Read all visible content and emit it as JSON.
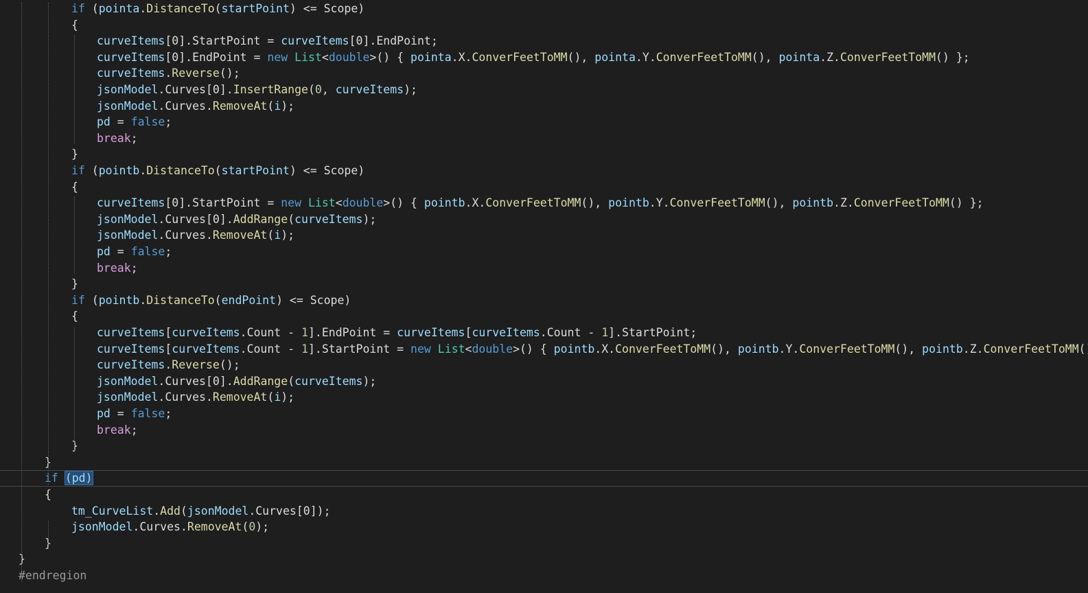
{
  "editor": {
    "colors": {
      "background": "#1e1e1e",
      "keyword": "#569cd6",
      "control": "#d8a0df",
      "type": "#4ec9b0",
      "identifier": "#9cdcfe",
      "method": "#dcdcaa",
      "number": "#b5cea8",
      "punctuation": "#dcdcdc",
      "preprocessor": "#9b9b9b",
      "selection": "#264f78"
    },
    "lines": [
      {
        "indent": 3,
        "tokens": [
          [
            "kw",
            "if"
          ],
          [
            "p",
            " ("
          ],
          [
            "id",
            "pointa"
          ],
          [
            "p",
            "."
          ],
          [
            "m",
            "DistanceTo"
          ],
          [
            "p",
            "("
          ],
          [
            "id",
            "startPoint"
          ],
          [
            "p",
            ") <= "
          ],
          [
            "pr",
            "Scope"
          ],
          [
            "p",
            ")"
          ]
        ]
      },
      {
        "indent": 3,
        "tokens": [
          [
            "p",
            "{"
          ]
        ]
      },
      {
        "indent": 4,
        "tokens": [
          [
            "id",
            "curveItems"
          ],
          [
            "p",
            "[0]."
          ],
          [
            "pr",
            "StartPoint"
          ],
          [
            "p",
            " = "
          ],
          [
            "id",
            "curveItems"
          ],
          [
            "p",
            "[0]."
          ],
          [
            "pr",
            "EndPoint"
          ],
          [
            "p",
            ";"
          ]
        ]
      },
      {
        "indent": 4,
        "tokens": [
          [
            "id",
            "curveItems"
          ],
          [
            "p",
            "[0]."
          ],
          [
            "pr",
            "EndPoint"
          ],
          [
            "p",
            " = "
          ],
          [
            "kw",
            "new"
          ],
          [
            "p",
            " "
          ],
          [
            "t",
            "List"
          ],
          [
            "p",
            "<"
          ],
          [
            "kw",
            "double"
          ],
          [
            "p",
            ">() { "
          ],
          [
            "id",
            "pointa"
          ],
          [
            "p",
            "."
          ],
          [
            "pr",
            "X"
          ],
          [
            "p",
            "."
          ],
          [
            "m",
            "ConverFeetToMM"
          ],
          [
            "p",
            "(), "
          ],
          [
            "id",
            "pointa"
          ],
          [
            "p",
            "."
          ],
          [
            "pr",
            "Y"
          ],
          [
            "p",
            "."
          ],
          [
            "m",
            "ConverFeetToMM"
          ],
          [
            "p",
            "(), "
          ],
          [
            "id",
            "pointa"
          ],
          [
            "p",
            "."
          ],
          [
            "pr",
            "Z"
          ],
          [
            "p",
            "."
          ],
          [
            "m",
            "ConverFeetToMM"
          ],
          [
            "p",
            "() };"
          ]
        ]
      },
      {
        "indent": 4,
        "tokens": [
          [
            "id",
            "curveItems"
          ],
          [
            "p",
            "."
          ],
          [
            "m",
            "Reverse"
          ],
          [
            "p",
            "();"
          ]
        ]
      },
      {
        "indent": 4,
        "tokens": [
          [
            "id",
            "jsonModel"
          ],
          [
            "p",
            "."
          ],
          [
            "pr",
            "Curves"
          ],
          [
            "p",
            "[0]."
          ],
          [
            "m",
            "InsertRange"
          ],
          [
            "p",
            "("
          ],
          [
            "n",
            "0"
          ],
          [
            "p",
            ", "
          ],
          [
            "id",
            "curveItems"
          ],
          [
            "p",
            ");"
          ]
        ]
      },
      {
        "indent": 4,
        "tokens": [
          [
            "id",
            "jsonModel"
          ],
          [
            "p",
            "."
          ],
          [
            "pr",
            "Curves"
          ],
          [
            "p",
            "."
          ],
          [
            "m",
            "RemoveAt"
          ],
          [
            "p",
            "("
          ],
          [
            "id",
            "i"
          ],
          [
            "p",
            ");"
          ]
        ]
      },
      {
        "indent": 4,
        "tokens": [
          [
            "id",
            "pd"
          ],
          [
            "p",
            " = "
          ],
          [
            "kw",
            "false"
          ],
          [
            "p",
            ";"
          ]
        ]
      },
      {
        "indent": 4,
        "tokens": [
          [
            "c",
            "break"
          ],
          [
            "p",
            ";"
          ]
        ]
      },
      {
        "indent": 3,
        "tokens": [
          [
            "p",
            "}"
          ]
        ]
      },
      {
        "indent": 3,
        "tokens": [
          [
            "kw",
            "if"
          ],
          [
            "p",
            " ("
          ],
          [
            "id",
            "pointb"
          ],
          [
            "p",
            "."
          ],
          [
            "m",
            "DistanceTo"
          ],
          [
            "p",
            "("
          ],
          [
            "id",
            "startPoint"
          ],
          [
            "p",
            ") <= "
          ],
          [
            "pr",
            "Scope"
          ],
          [
            "p",
            ")"
          ]
        ]
      },
      {
        "indent": 3,
        "tokens": [
          [
            "p",
            "{"
          ]
        ]
      },
      {
        "indent": 4,
        "tokens": [
          [
            "id",
            "curveItems"
          ],
          [
            "p",
            "[0]."
          ],
          [
            "pr",
            "StartPoint"
          ],
          [
            "p",
            " = "
          ],
          [
            "kw",
            "new"
          ],
          [
            "p",
            " "
          ],
          [
            "t",
            "List"
          ],
          [
            "p",
            "<"
          ],
          [
            "kw",
            "double"
          ],
          [
            "p",
            ">() { "
          ],
          [
            "id",
            "pointb"
          ],
          [
            "p",
            "."
          ],
          [
            "pr",
            "X"
          ],
          [
            "p",
            "."
          ],
          [
            "m",
            "ConverFeetToMM"
          ],
          [
            "p",
            "(), "
          ],
          [
            "id",
            "pointb"
          ],
          [
            "p",
            "."
          ],
          [
            "pr",
            "Y"
          ],
          [
            "p",
            "."
          ],
          [
            "m",
            "ConverFeetToMM"
          ],
          [
            "p",
            "(), "
          ],
          [
            "id",
            "pointb"
          ],
          [
            "p",
            "."
          ],
          [
            "pr",
            "Z"
          ],
          [
            "p",
            "."
          ],
          [
            "m",
            "ConverFeetToMM"
          ],
          [
            "p",
            "() };"
          ]
        ]
      },
      {
        "indent": 4,
        "tokens": [
          [
            "id",
            "jsonModel"
          ],
          [
            "p",
            "."
          ],
          [
            "pr",
            "Curves"
          ],
          [
            "p",
            "[0]."
          ],
          [
            "m",
            "AddRange"
          ],
          [
            "p",
            "("
          ],
          [
            "id",
            "curveItems"
          ],
          [
            "p",
            ");"
          ]
        ]
      },
      {
        "indent": 4,
        "tokens": [
          [
            "id",
            "jsonModel"
          ],
          [
            "p",
            "."
          ],
          [
            "pr",
            "Curves"
          ],
          [
            "p",
            "."
          ],
          [
            "m",
            "RemoveAt"
          ],
          [
            "p",
            "("
          ],
          [
            "id",
            "i"
          ],
          [
            "p",
            ");"
          ]
        ]
      },
      {
        "indent": 4,
        "tokens": [
          [
            "id",
            "pd"
          ],
          [
            "p",
            " = "
          ],
          [
            "kw",
            "false"
          ],
          [
            "p",
            ";"
          ]
        ]
      },
      {
        "indent": 4,
        "tokens": [
          [
            "c",
            "break"
          ],
          [
            "p",
            ";"
          ]
        ]
      },
      {
        "indent": 3,
        "tokens": [
          [
            "p",
            "}"
          ]
        ]
      },
      {
        "indent": 3,
        "tokens": [
          [
            "kw",
            "if"
          ],
          [
            "p",
            " ("
          ],
          [
            "id",
            "pointb"
          ],
          [
            "p",
            "."
          ],
          [
            "m",
            "DistanceTo"
          ],
          [
            "p",
            "("
          ],
          [
            "id",
            "endPoint"
          ],
          [
            "p",
            ") <= "
          ],
          [
            "pr",
            "Scope"
          ],
          [
            "p",
            ")"
          ]
        ]
      },
      {
        "indent": 3,
        "tokens": [
          [
            "p",
            "{"
          ]
        ]
      },
      {
        "indent": 4,
        "tokens": [
          [
            "id",
            "curveItems"
          ],
          [
            "p",
            "["
          ],
          [
            "id",
            "curveItems"
          ],
          [
            "p",
            "."
          ],
          [
            "pr",
            "Count"
          ],
          [
            "p",
            " - "
          ],
          [
            "n",
            "1"
          ],
          [
            "p",
            "]."
          ],
          [
            "pr",
            "EndPoint"
          ],
          [
            "p",
            " = "
          ],
          [
            "id",
            "curveItems"
          ],
          [
            "p",
            "["
          ],
          [
            "id",
            "curveItems"
          ],
          [
            "p",
            "."
          ],
          [
            "pr",
            "Count"
          ],
          [
            "p",
            " - "
          ],
          [
            "n",
            "1"
          ],
          [
            "p",
            "]."
          ],
          [
            "pr",
            "StartPoint"
          ],
          [
            "p",
            ";"
          ]
        ]
      },
      {
        "indent": 4,
        "tokens": [
          [
            "id",
            "curveItems"
          ],
          [
            "p",
            "["
          ],
          [
            "id",
            "curveItems"
          ],
          [
            "p",
            "."
          ],
          [
            "pr",
            "Count"
          ],
          [
            "p",
            " - "
          ],
          [
            "n",
            "1"
          ],
          [
            "p",
            "]."
          ],
          [
            "pr",
            "StartPoint"
          ],
          [
            "p",
            " = "
          ],
          [
            "kw",
            "new"
          ],
          [
            "p",
            " "
          ],
          [
            "t",
            "List"
          ],
          [
            "p",
            "<"
          ],
          [
            "kw",
            "double"
          ],
          [
            "p",
            ">() { "
          ],
          [
            "id",
            "pointb"
          ],
          [
            "p",
            "."
          ],
          [
            "pr",
            "X"
          ],
          [
            "p",
            "."
          ],
          [
            "m",
            "ConverFeetToMM"
          ],
          [
            "p",
            "(), "
          ],
          [
            "id",
            "pointb"
          ],
          [
            "p",
            "."
          ],
          [
            "pr",
            "Y"
          ],
          [
            "p",
            "."
          ],
          [
            "m",
            "ConverFeetToMM"
          ],
          [
            "p",
            "(), "
          ],
          [
            "id",
            "pointb"
          ],
          [
            "p",
            "."
          ],
          [
            "pr",
            "Z"
          ],
          [
            "p",
            "."
          ],
          [
            "m",
            "ConverFeetToMM"
          ],
          [
            "p",
            "() };"
          ]
        ]
      },
      {
        "indent": 4,
        "tokens": [
          [
            "id",
            "curveItems"
          ],
          [
            "p",
            "."
          ],
          [
            "m",
            "Reverse"
          ],
          [
            "p",
            "();"
          ]
        ]
      },
      {
        "indent": 4,
        "tokens": [
          [
            "id",
            "jsonModel"
          ],
          [
            "p",
            "."
          ],
          [
            "pr",
            "Curves"
          ],
          [
            "p",
            "[0]."
          ],
          [
            "m",
            "AddRange"
          ],
          [
            "p",
            "("
          ],
          [
            "id",
            "curveItems"
          ],
          [
            "p",
            ");"
          ]
        ]
      },
      {
        "indent": 4,
        "tokens": [
          [
            "id",
            "jsonModel"
          ],
          [
            "p",
            "."
          ],
          [
            "pr",
            "Curves"
          ],
          [
            "p",
            "."
          ],
          [
            "m",
            "RemoveAt"
          ],
          [
            "p",
            "("
          ],
          [
            "id",
            "i"
          ],
          [
            "p",
            ");"
          ]
        ]
      },
      {
        "indent": 4,
        "tokens": [
          [
            "id",
            "pd"
          ],
          [
            "p",
            " = "
          ],
          [
            "kw",
            "false"
          ],
          [
            "p",
            ";"
          ]
        ]
      },
      {
        "indent": 4,
        "tokens": [
          [
            "c",
            "break"
          ],
          [
            "p",
            ";"
          ]
        ]
      },
      {
        "indent": 3,
        "tokens": [
          [
            "p",
            "}"
          ]
        ]
      },
      {
        "indent": 2,
        "tokens": [
          [
            "p",
            "}"
          ]
        ]
      },
      {
        "indent": 2,
        "current": true,
        "tokens": [
          [
            "kw",
            "if"
          ],
          [
            "p",
            " "
          ],
          [
            "hl",
            "(pd)"
          ]
        ]
      },
      {
        "indent": 2,
        "tokens": [
          [
            "p",
            "{"
          ]
        ]
      },
      {
        "indent": 3,
        "tokens": [
          [
            "id",
            "tm_CurveList"
          ],
          [
            "p",
            "."
          ],
          [
            "m",
            "Add"
          ],
          [
            "p",
            "("
          ],
          [
            "id",
            "jsonModel"
          ],
          [
            "p",
            "."
          ],
          [
            "pr",
            "Curves"
          ],
          [
            "p",
            "[0]);"
          ]
        ]
      },
      {
        "indent": 3,
        "tokens": [
          [
            "id",
            "jsonModel"
          ],
          [
            "p",
            "."
          ],
          [
            "pr",
            "Curves"
          ],
          [
            "p",
            "."
          ],
          [
            "m",
            "RemoveAt"
          ],
          [
            "p",
            "("
          ],
          [
            "n",
            "0"
          ],
          [
            "p",
            ");"
          ]
        ]
      },
      {
        "indent": 2,
        "tokens": [
          [
            "p",
            "}"
          ]
        ]
      },
      {
        "indent": 1,
        "tokens": [
          [
            "p",
            "}"
          ]
        ]
      },
      {
        "indent": 1,
        "tokens": [
          [
            "pre",
            "#endregion"
          ]
        ]
      }
    ]
  }
}
